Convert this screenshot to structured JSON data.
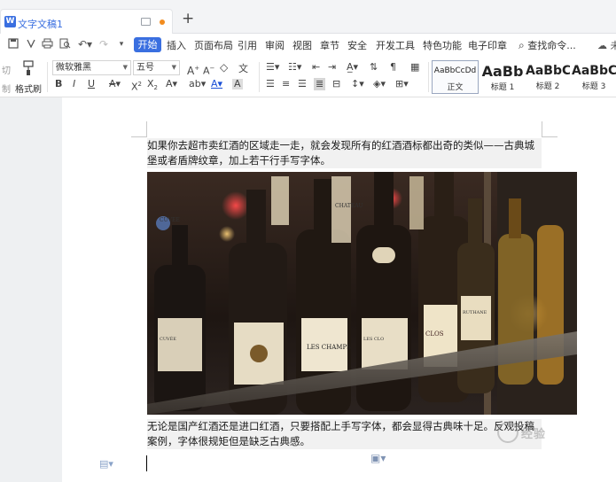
{
  "titlebar": {
    "doc_title": "文字文稿1",
    "app_badge": "W",
    "new_tab": "+"
  },
  "menu": {
    "tabs": [
      "开始",
      "插入",
      "页面布局",
      "引用",
      "审阅",
      "视图",
      "章节",
      "安全",
      "开发工具",
      "特色功能",
      "电子印章"
    ],
    "active_tab": "开始",
    "search_placeholder": "查找命令...",
    "cloud_label": "未"
  },
  "ribbon": {
    "cut_label": "切",
    "paste_label": "制",
    "format_painter_label": "格式刷",
    "font_name": "微软雅黑",
    "font_size": "五号",
    "styles": [
      {
        "preview": "AaBbCcDd",
        "name": "正文",
        "selected": true
      },
      {
        "preview": "AaBb",
        "name": "标题 1",
        "selected": false
      },
      {
        "preview": "AaBbC",
        "name": "标题 2",
        "selected": false
      },
      {
        "preview": "AaBbC",
        "name": "标题 3",
        "selected": false
      }
    ]
  },
  "document": {
    "paragraph1": "如果你去超市卖红酒的区域走一走，就会发现所有的红酒酒标都出奇的类似——古典城堡或者盾牌纹章，加上若干行手写字体。",
    "paragraph2": "无论是国产红酒还是进口红酒，只要搭配上手写字体，都会显得古典味十足。反观投稿案例，字体很规矩但是缺乏古典感。",
    "watermark": "经验",
    "photo_labels": [
      "CUVEE",
      "CHATEAU",
      "LES CHAMPS",
      "CLOS",
      "LES CLO",
      "CUVÉE",
      "RUTHANE"
    ]
  }
}
